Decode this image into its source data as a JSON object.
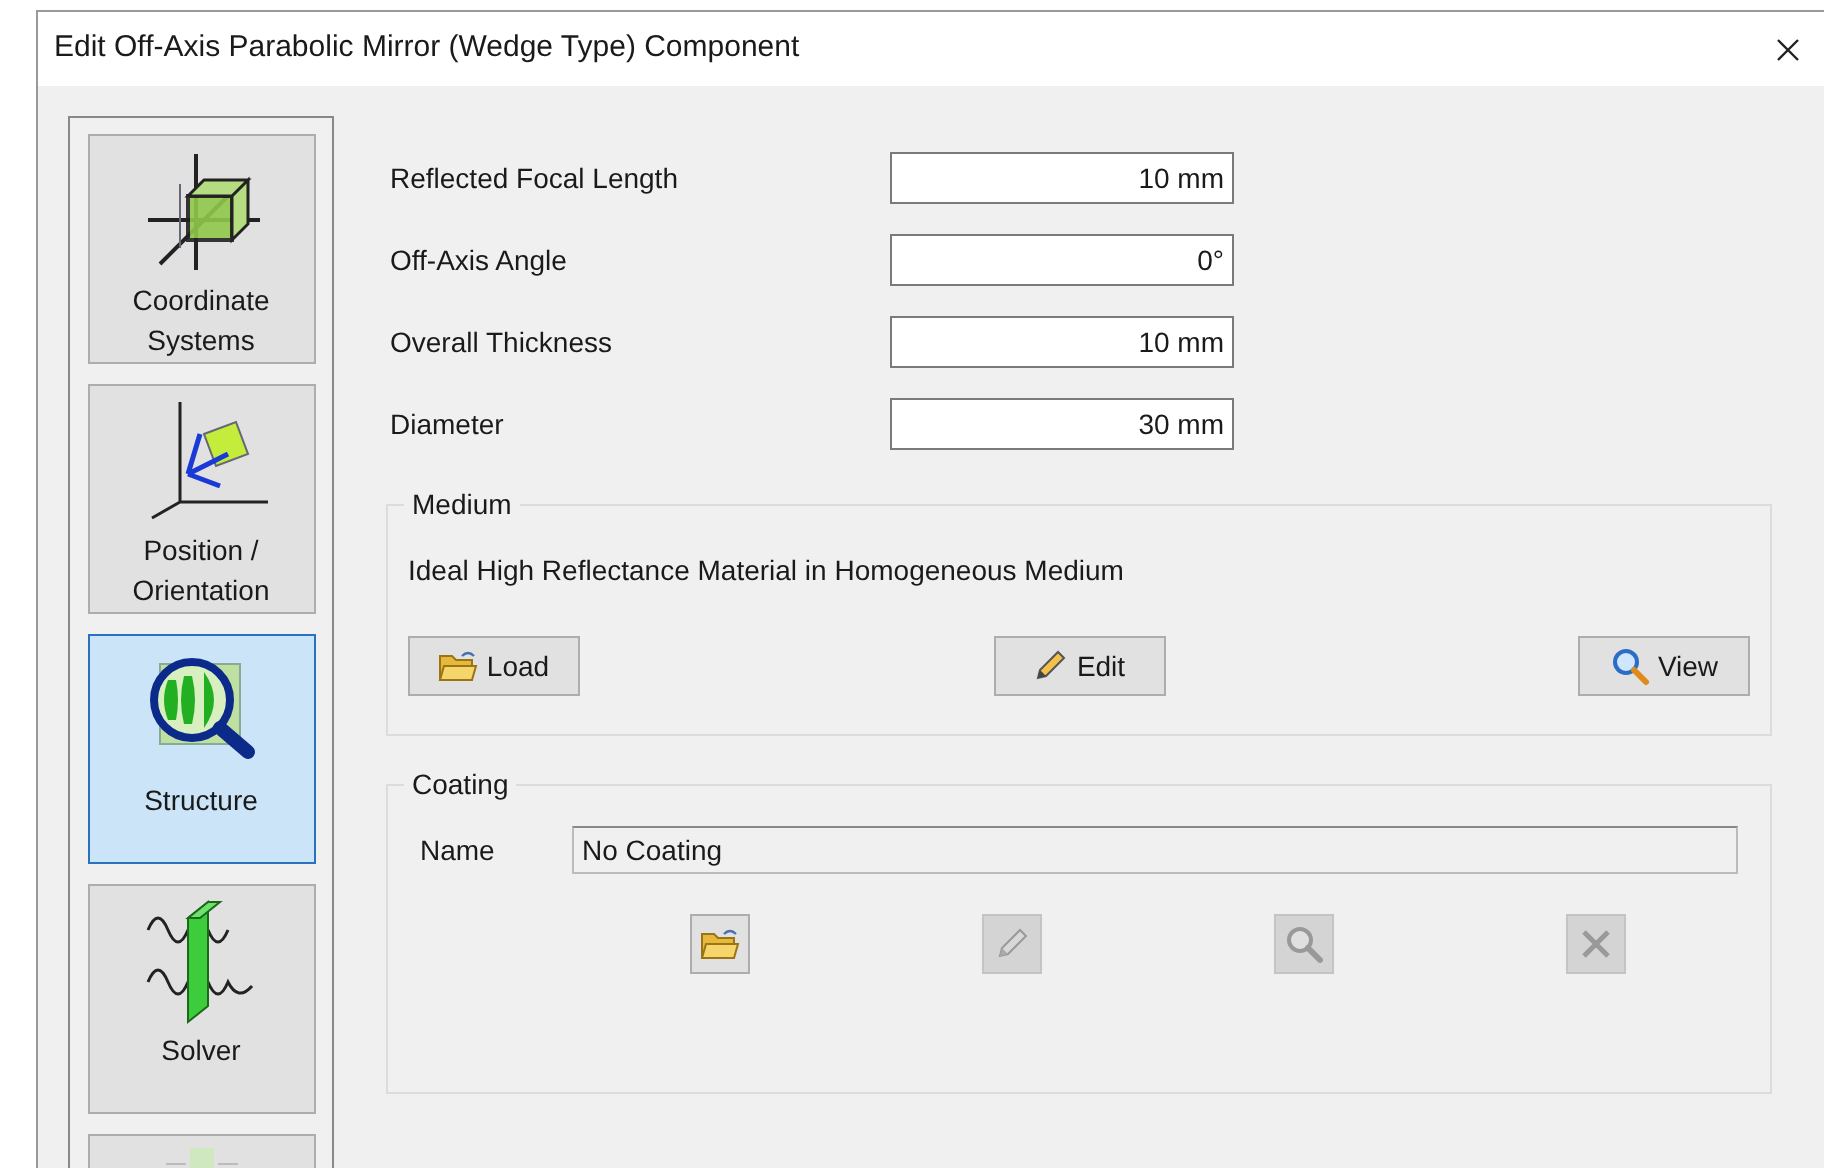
{
  "window": {
    "title": "Edit Off-Axis Parabolic Mirror (Wedge Type) Component"
  },
  "sidebar": {
    "items": [
      {
        "kind": "coordinates",
        "label": "Coordinate Systems",
        "selected": false
      },
      {
        "kind": "position",
        "label": "Position / Orientation",
        "selected": false
      },
      {
        "kind": "structure",
        "label": "Structure",
        "selected": true
      },
      {
        "kind": "solver",
        "label": "Solver",
        "selected": false
      },
      {
        "kind": "other",
        "selected": false
      }
    ]
  },
  "fields": [
    {
      "label": "Reflected Focal Length",
      "value": "10 mm"
    },
    {
      "label": "Off-Axis Angle",
      "value": "0°"
    },
    {
      "label": "Overall Thickness",
      "value": "10 mm"
    },
    {
      "label": "Diameter",
      "value": "30 mm"
    }
  ],
  "medium": {
    "title": "Medium",
    "description": "Ideal High Reflectance Material in Homogeneous Medium",
    "buttons": [
      {
        "kind": "load",
        "label": "Load"
      },
      {
        "kind": "edit",
        "label": "Edit"
      },
      {
        "kind": "view",
        "label": "View"
      }
    ]
  },
  "coating": {
    "title": "Coating",
    "name_label": "Name",
    "name_value": "No Coating",
    "buttons": [
      {
        "kind": "load",
        "disabled": false
      },
      {
        "kind": "edit",
        "disabled": true
      },
      {
        "kind": "view",
        "disabled": true
      },
      {
        "kind": "delete",
        "disabled": true
      }
    ]
  }
}
